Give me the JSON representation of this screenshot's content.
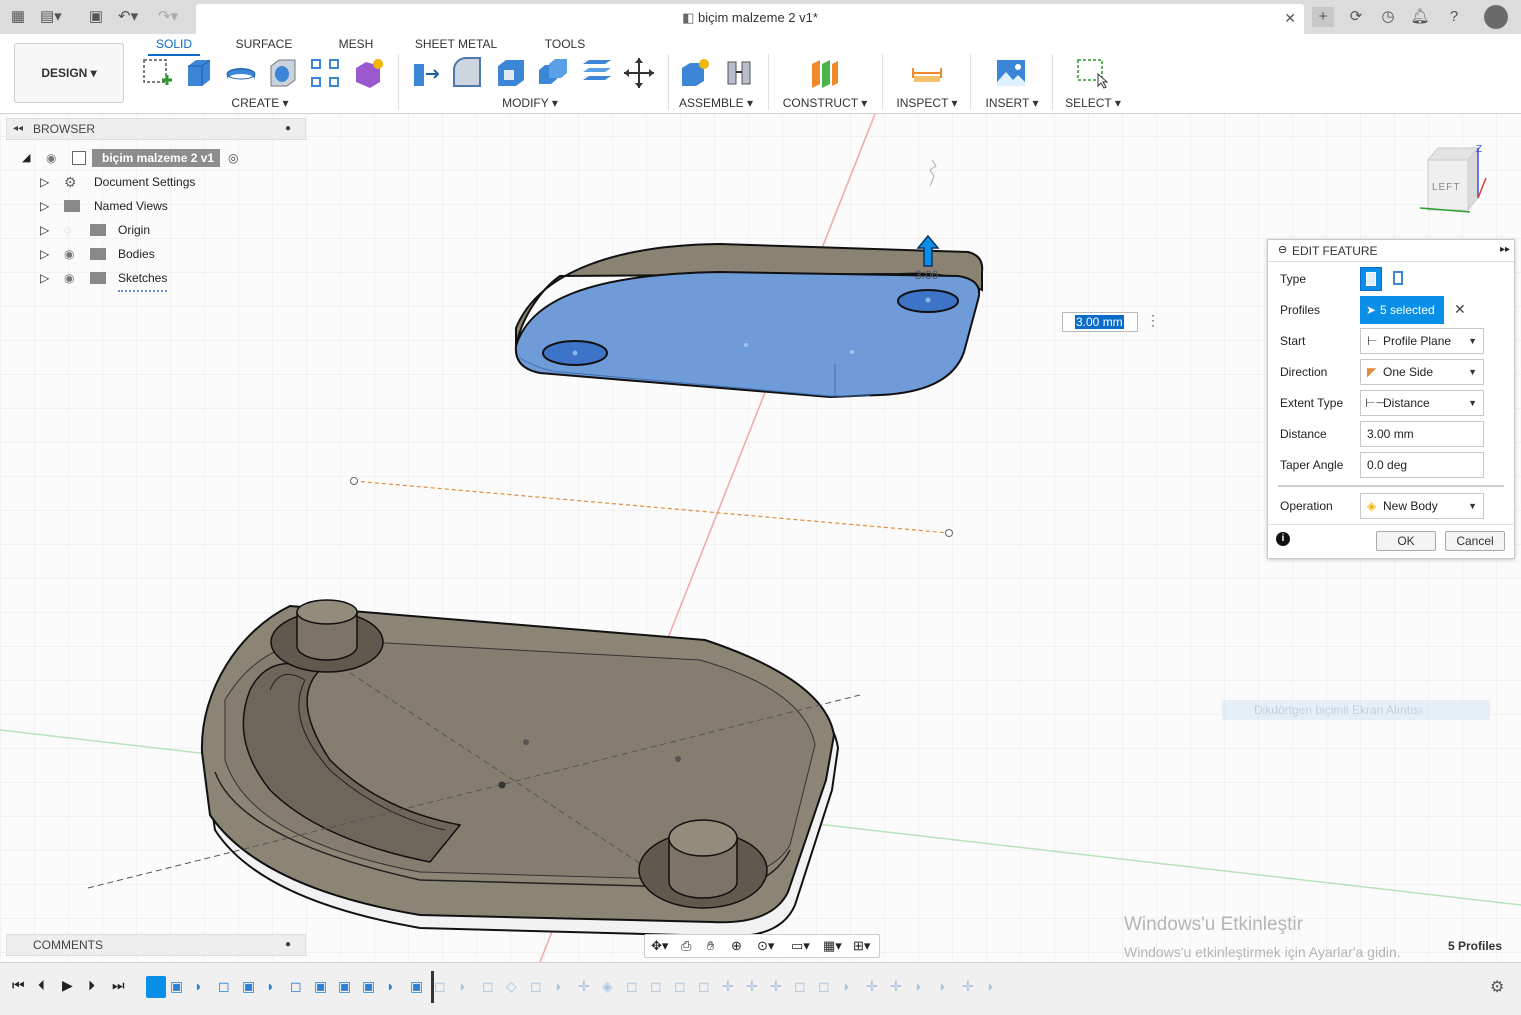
{
  "app": {
    "doc_title": "biçim malzeme 2 v1*",
    "accent": "#0a6bc8"
  },
  "workspace_tabs": [
    "SOLID",
    "SURFACE",
    "MESH",
    "SHEET METAL",
    "TOOLS"
  ],
  "toolbar": {
    "design": "DESIGN",
    "groups": [
      "CREATE",
      "MODIFY",
      "ASSEMBLE",
      "CONSTRUCT",
      "INSPECT",
      "INSERT",
      "SELECT"
    ]
  },
  "browser": {
    "title": "BROWSER",
    "root": "biçim malzeme 2 v1",
    "items": [
      "Document Settings",
      "Named Views",
      "Origin",
      "Bodies",
      "Sketches"
    ]
  },
  "comments": {
    "title": "COMMENTS"
  },
  "viewcube": {
    "face": "LEFT",
    "axis": "Z"
  },
  "viewport": {
    "dim_label": "3.00",
    "dim_input": "3.00 mm",
    "tooltip": "Dikdörtgen biçimli Ekran Alıntısı",
    "watermark_title": "Windows'u Etkinleştir",
    "watermark_sub": "Windows'u etkinleştirmek için Ayarlar'a gidin.",
    "status": "5 Profiles"
  },
  "edit_feature": {
    "title": "EDIT FEATURE",
    "labels": [
      "Type",
      "Profiles",
      "Start",
      "Direction",
      "Extent Type",
      "Distance",
      "Taper Angle",
      "Operation"
    ],
    "profiles": "5 selected",
    "start": "Profile Plane",
    "direction": "One Side",
    "extent_type": "Distance",
    "distance": "3.00 mm",
    "taper_angle": "0.0 deg",
    "operation": "New Body",
    "ok": "OK",
    "cancel": "Cancel"
  }
}
